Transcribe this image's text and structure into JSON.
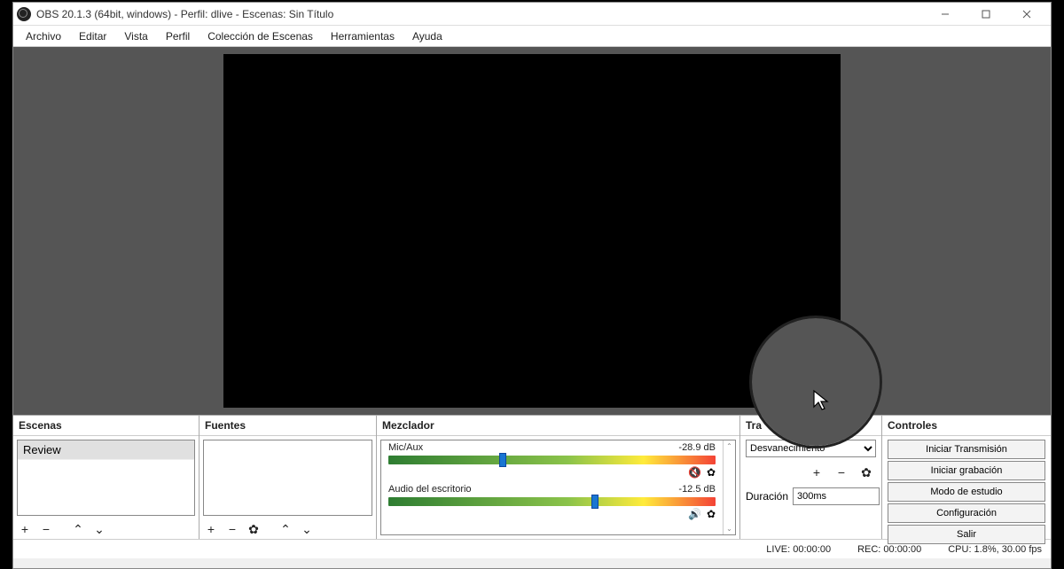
{
  "window": {
    "title": "OBS 20.1.3 (64bit, windows) - Perfil: dlive - Escenas: Sin Título"
  },
  "menubar": {
    "items": [
      "Archivo",
      "Editar",
      "Vista",
      "Perfil",
      "Colección de Escenas",
      "Herramientas",
      "Ayuda"
    ]
  },
  "panels": {
    "scenes": {
      "title": "Escenas",
      "items": [
        "Review"
      ]
    },
    "sources": {
      "title": "Fuentes"
    },
    "mixer": {
      "title": "Mezclador",
      "channels": [
        {
          "name": "Mic/Aux",
          "db": "-28.9 dB",
          "handle_pct": 34,
          "muted": true
        },
        {
          "name": "Audio del escritorio",
          "db": "-12.5 dB",
          "handle_pct": 62,
          "muted": false
        }
      ]
    },
    "transitions": {
      "title": "Tra",
      "selected": "Desvanecimiento",
      "duration_label": "Duración",
      "duration_value": "300ms"
    },
    "controls": {
      "title": "Controles",
      "buttons": [
        "Iniciar Transmisión",
        "Iniciar grabación",
        "Modo de estudio",
        "Configuración",
        "Salir"
      ]
    }
  },
  "statusbar": {
    "live": "LIVE: 00:00:00",
    "rec": "REC: 00:00:00",
    "cpu": "CPU: 1.8%, 30.00 fps"
  }
}
